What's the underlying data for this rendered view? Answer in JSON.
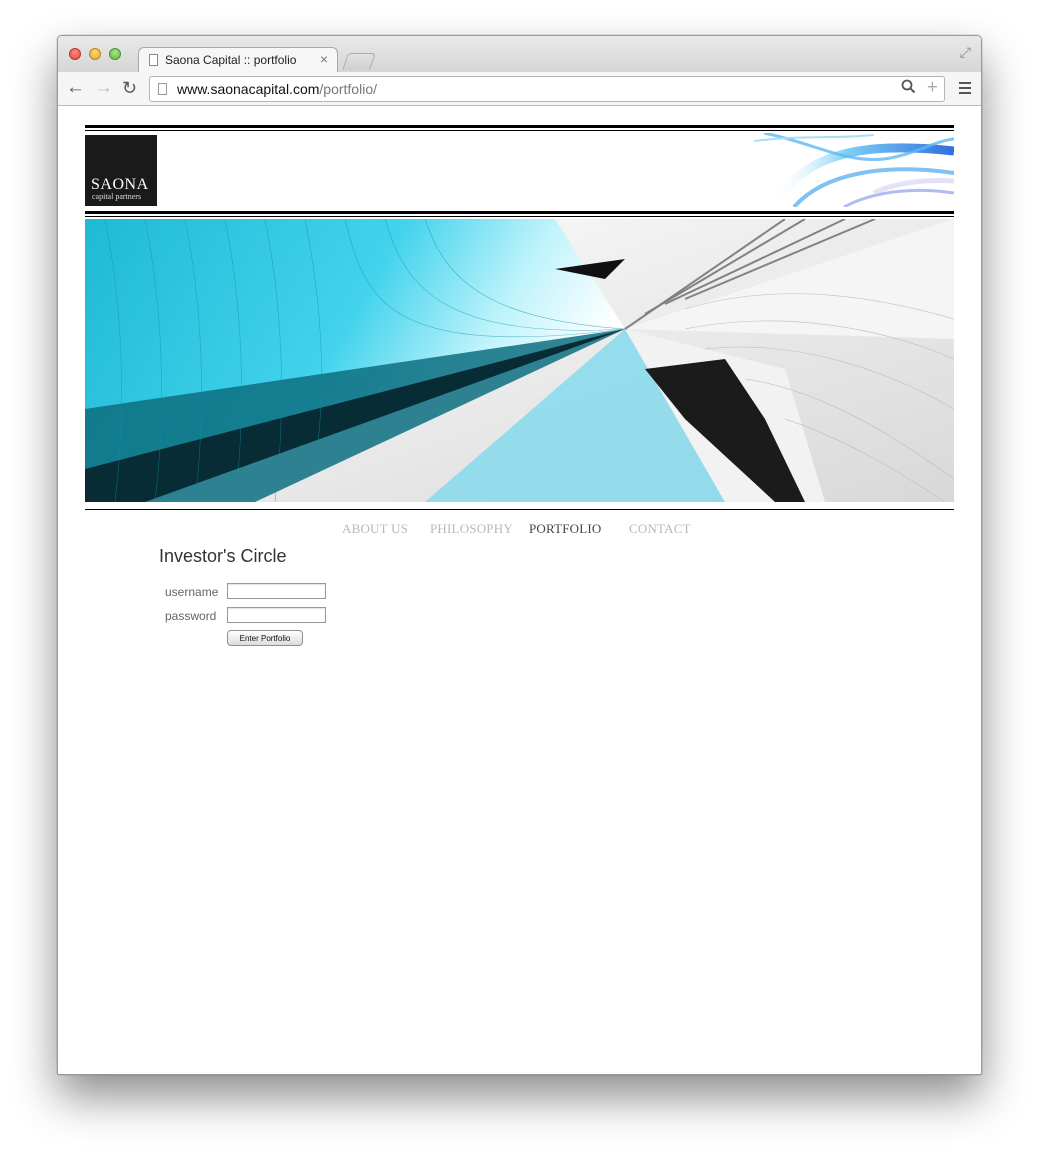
{
  "browser": {
    "tab_title": "Saona Capital :: portfolio",
    "tab_close": "×",
    "url_host": "www.saonacapital.com",
    "url_path": "/portfolio/",
    "icons": {
      "back": "←",
      "forward": "→",
      "reload": "↻",
      "search": "🔍",
      "bookmark": "+",
      "fullscreen": "⤢"
    }
  },
  "site": {
    "logo_main": "SAONA",
    "logo_sub": "capital partners",
    "nav": [
      {
        "label": "ABOUT US",
        "active": false
      },
      {
        "label": "PHILOSOPHY",
        "active": false
      },
      {
        "label": "PORTFOLIO",
        "active": true
      },
      {
        "label": "CONTACT",
        "active": false
      }
    ],
    "login": {
      "title": "Investor's Circle",
      "username_label": "username",
      "password_label": "password",
      "username_value": "",
      "password_value": "",
      "submit_label": "Enter Portfolio"
    }
  },
  "colors": {
    "accent_cyan": "#2ec6e0",
    "nav_inactive": "#b8b8b8",
    "nav_active": "#444444"
  }
}
